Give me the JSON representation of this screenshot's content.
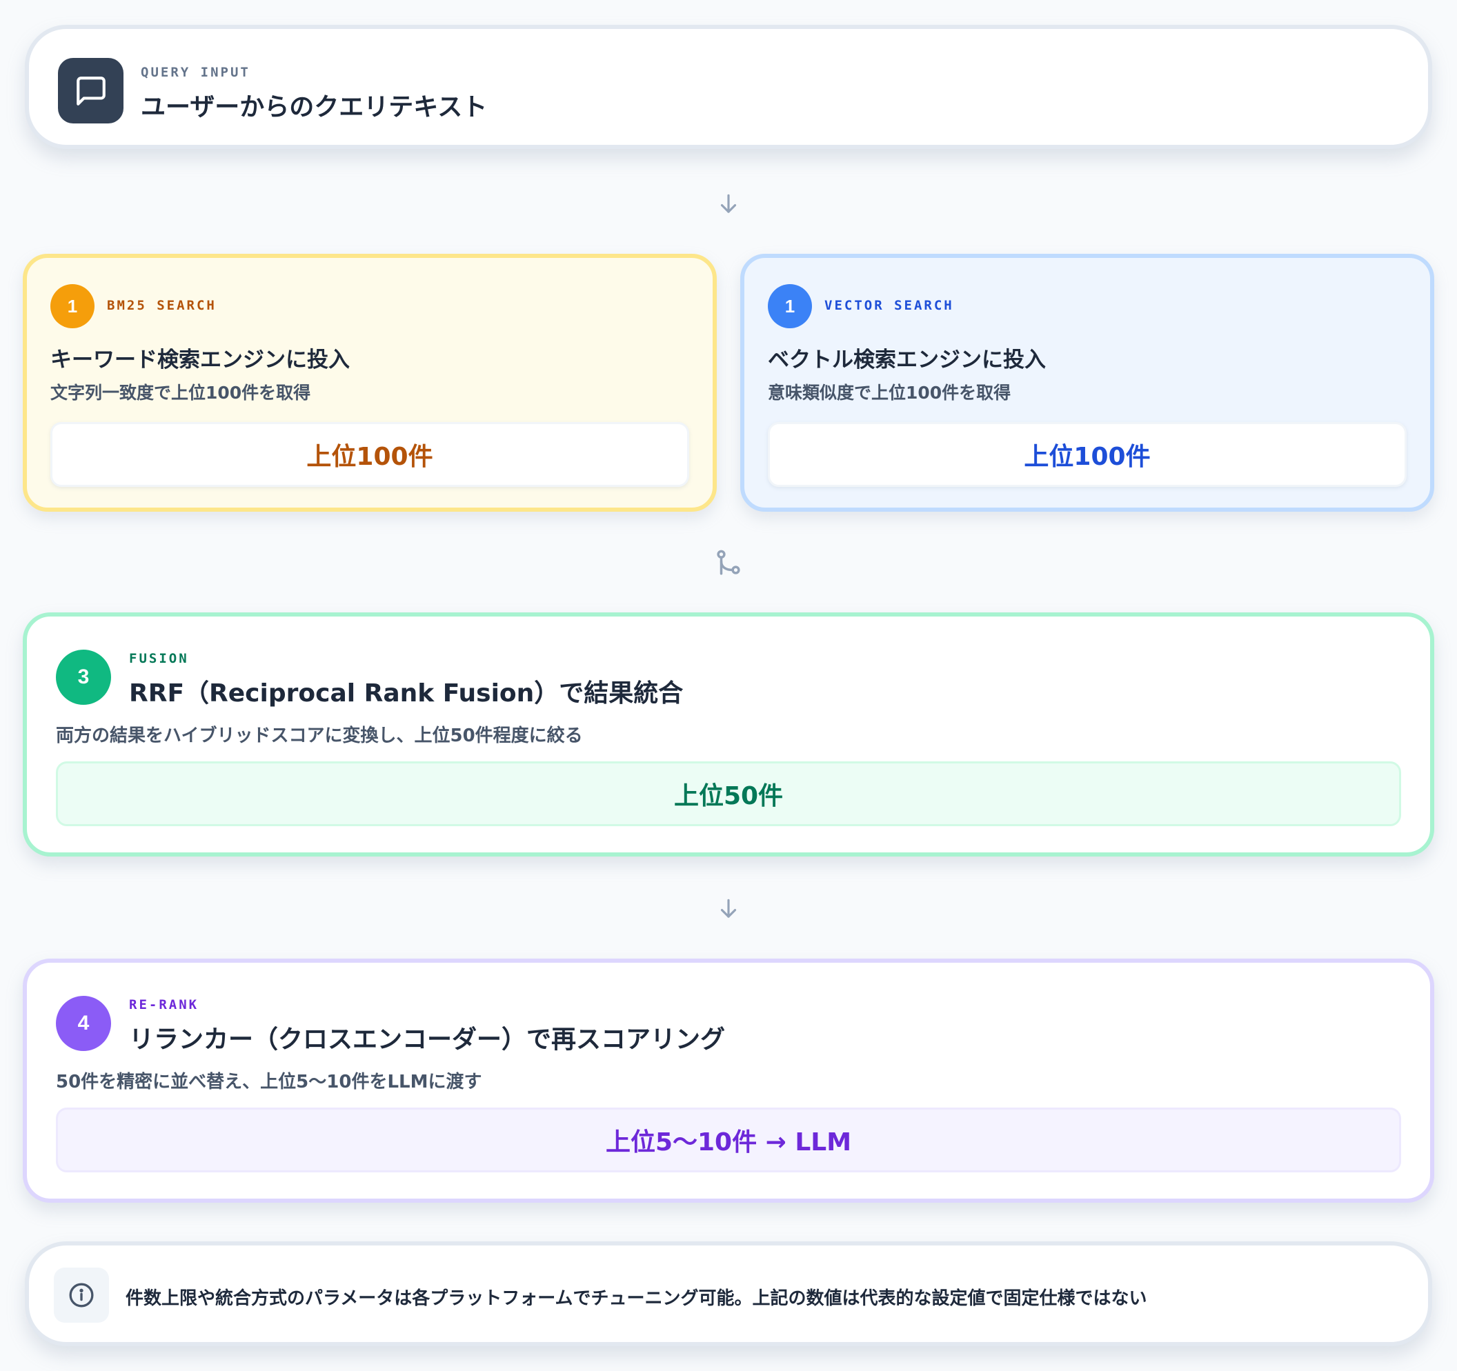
{
  "query": {
    "eyebrow": "QUERY INPUT",
    "title": "ユーザーからのクエリテキスト",
    "icon": "message-square-icon"
  },
  "bm25": {
    "step": "1",
    "eyebrow": "BM25 SEARCH",
    "title": "キーワード検索エンジンに投入",
    "desc": "文字列一致度で上位100件を取得",
    "result": "上位100件",
    "accent": "#f59e0b",
    "text_color": "#b45309"
  },
  "vector": {
    "step": "1",
    "eyebrow": "VECTOR SEARCH",
    "title": "ベクトル検索エンジンに投入",
    "desc": "意味類似度で上位100件を取得",
    "result": "上位100件",
    "accent": "#3b82f6",
    "text_color": "#1d4ed8"
  },
  "fusion": {
    "step": "3",
    "eyebrow": "FUSION",
    "title": "RRF（Reciprocal Rank Fusion）で結果統合",
    "desc": "両方の結果をハイブリッドスコアに変換し、上位50件程度に絞る",
    "result": "上位50件",
    "accent": "#10b981",
    "text_color": "#047857"
  },
  "rerank": {
    "step": "4",
    "eyebrow": "RE-RANK",
    "title": "リランカー（クロスエンコーダー）で再スコアリング",
    "desc": "50件を精密に並べ替え、上位5〜10件をLLMに渡す",
    "result": "上位5〜10件 → LLM",
    "accent": "#8b5cf6",
    "text_color": "#6d28d9"
  },
  "note": {
    "icon": "info-icon",
    "text": "件数上限や統合方式のパラメータは各プラットフォームでチューニング可能。上記の数値は代表的な設定値で固定仕様ではない"
  }
}
